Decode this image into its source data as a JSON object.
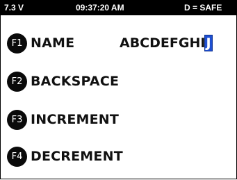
{
  "status_bar": {
    "voltage": "7.3 V",
    "time": "09:37:20 AM",
    "mode": "D = SAFE"
  },
  "menu": {
    "items": [
      {
        "key": "F1",
        "label": "NAME"
      },
      {
        "key": "F2",
        "label": "BACKSPACE"
      },
      {
        "key": "F3",
        "label": "INCREMENT"
      },
      {
        "key": "F4",
        "label": "DECREMENT"
      }
    ]
  },
  "name_field": {
    "text": "ABCDEFGHI",
    "cursor_char": "J"
  },
  "colors": {
    "status_bar_bg": "#000000",
    "cursor_highlight": "#1e4fd1",
    "fkey_bg": "#0a0a0a"
  }
}
